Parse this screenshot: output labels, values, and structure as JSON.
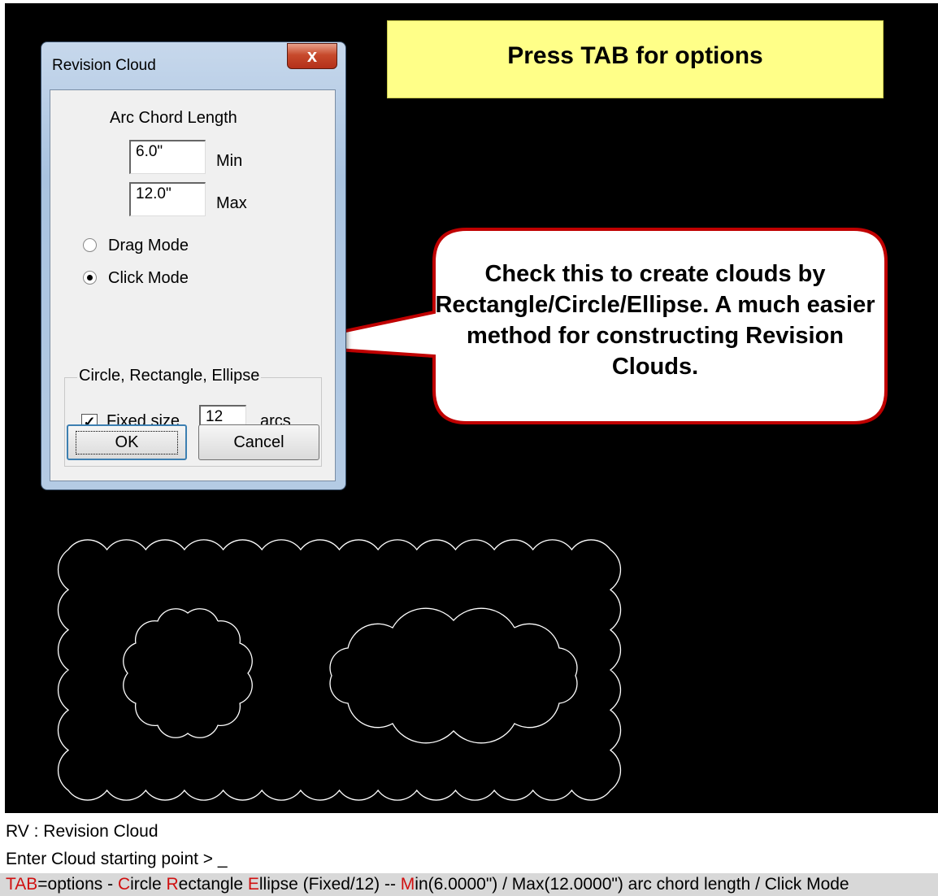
{
  "banner": {
    "text": "Press TAB for options"
  },
  "dialog": {
    "title": "Revision Cloud",
    "close_label": "x",
    "arc_chord_label": "Arc Chord Length",
    "min_value": "6.0\"",
    "min_label": "Min",
    "max_value": "12.0\"",
    "max_label": "Max",
    "drag_mode_label": "Drag Mode",
    "click_mode_label": "Click Mode",
    "selected_mode": "Click Mode",
    "group_title": "Circle, Rectangle, Ellipse",
    "fixed_size_label": "Fixed size",
    "fixed_size_checked": true,
    "arcs_value": "12",
    "arcs_label": "arcs",
    "ok_label": "OK",
    "cancel_label": "Cancel"
  },
  "callout": {
    "text": "Check this to create clouds by Rectangle/Circle/Ellipse. A much easier method for constructing Revision Clouds."
  },
  "command": {
    "line1": "RV : Revision Cloud",
    "line2": "Enter Cloud starting point > _",
    "line3_parts": [
      "T",
      "AB",
      "=options - ",
      "C",
      "ircle  ",
      "R",
      "ectangle  ",
      "E",
      "llipse (Fixed/12) --  ",
      "M",
      "in(6.0000\") / Max(12.0000\") arc chord length / Click Mode"
    ]
  },
  "colors": {
    "canvas": "#000000",
    "banner": "#ffff88",
    "hotkey": "#d01010",
    "callout_border": "#c00000"
  }
}
